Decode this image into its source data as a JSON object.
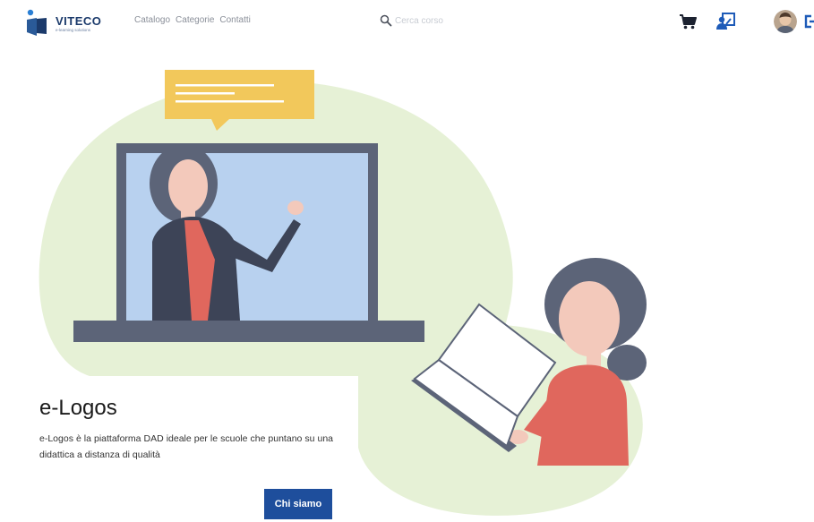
{
  "header": {
    "logo_text": "VITECO",
    "logo_subtext": "e-learning solutions",
    "nav": [
      "Catalogo",
      "Categorie",
      "Contatti"
    ],
    "search_placeholder": "Cerca corso"
  },
  "icons": {
    "logo": "viteco-logo-icon",
    "search": "search-icon",
    "cart": "cart-icon",
    "classroom": "classroom-icon",
    "avatar": "user-avatar",
    "logout": "logout-icon"
  },
  "hero": {
    "title": "e-Logos",
    "description": "e-Logos è la piattaforma DAD ideale per le scuole che puntano su una didattica a distanza di qualità",
    "button_label": "Chi siamo"
  },
  "colors": {
    "brand": "#1b3a6b",
    "button": "#1e4e9c",
    "blob": "#e6f1d6",
    "screen": "#b8d1ef",
    "laptop": "#5c6478",
    "speech_bubble": "#f2c85b",
    "accent_red": "#e0675d"
  }
}
